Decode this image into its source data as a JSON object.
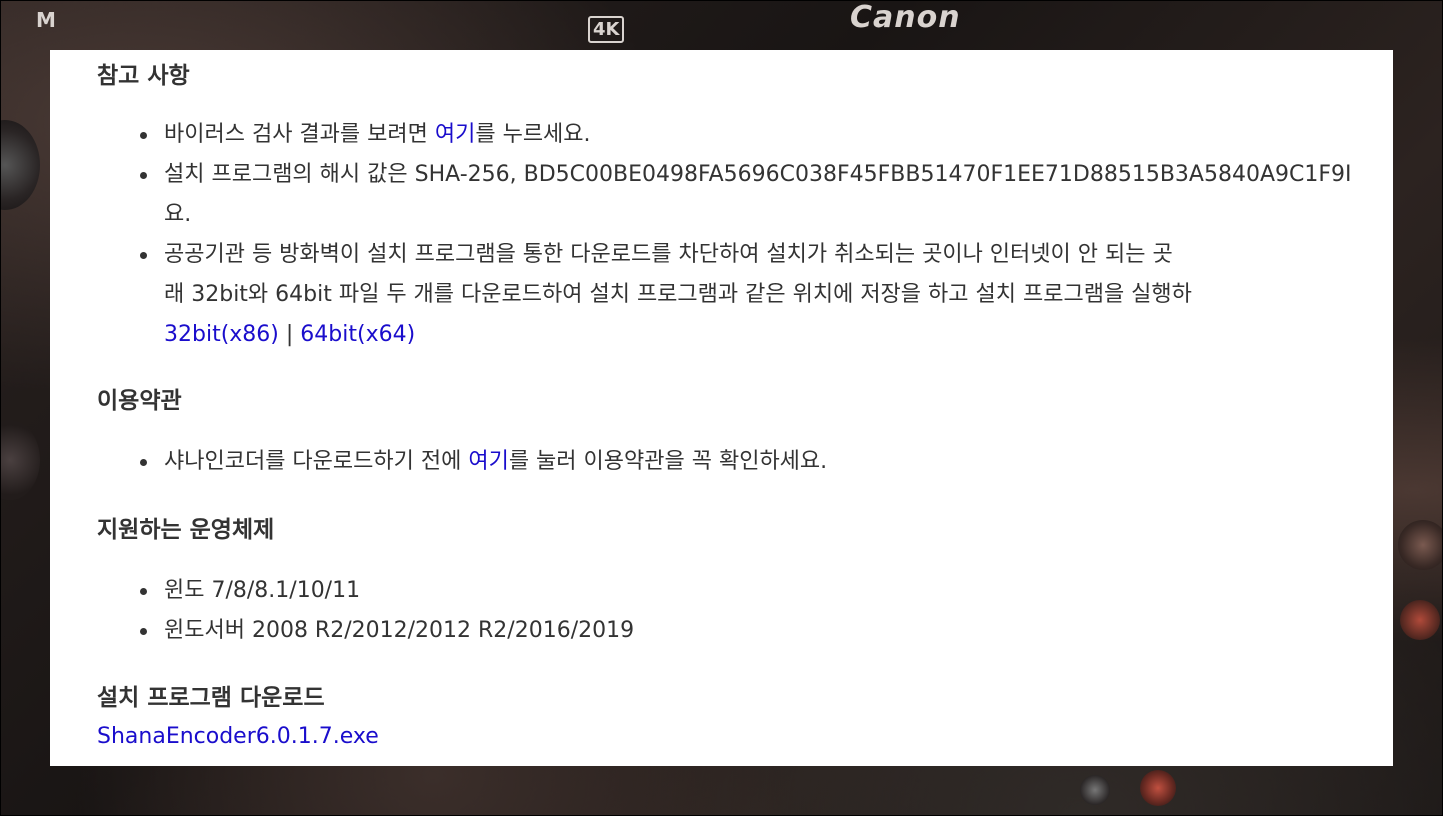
{
  "background": {
    "brand_text": "Canon",
    "badge_text": "4K",
    "corner_mark": "M"
  },
  "notes": {
    "heading": "참고 사항",
    "virus_scan": {
      "before": "바이러스 검사 결과를 보려면 ",
      "link": "여기",
      "after": "를 누르세요."
    },
    "hash": {
      "line1": "설치 프로그램의 해시 값은 SHA-256, BD5C00BE0498FA5696C038F45FBB51470F1EE71D88515B3A5840A9C1F9I",
      "line2": "요."
    },
    "firewall": {
      "line1": "공공기관 등 방화벽이 설치 프로그램을 통한 다운로드를 차단하여 설치가 취소되는 곳이나 인터넷이 안 되는 곳",
      "line2": "래 32bit와 64bit 파일 두 개를 다운로드하여 설치 프로그램과 같은 위치에 저장을 하고 설치 프로그램을 실행하",
      "link_32": "32bit(x86)",
      "separator": " | ",
      "link_64": "64bit(x64)"
    }
  },
  "terms": {
    "heading": "이용약관",
    "item": {
      "before": "샤나인코더를 다운로드하기 전에 ",
      "link": "여기",
      "after": "를 눌러 이용약관을 꼭 확인하세요."
    }
  },
  "os": {
    "heading": "지원하는 운영체제",
    "items": [
      "윈도 7/8/8.1/10/11",
      "윈도서버 2008 R2/2012/2012 R2/2016/2019"
    ]
  },
  "installer": {
    "heading": "설치 프로그램 다운로드",
    "file_link": "ShanaEncoder6.0.1.7.exe"
  },
  "colors": {
    "link": "#1a0dcc",
    "text": "#333333",
    "panel": "#ffffff"
  }
}
